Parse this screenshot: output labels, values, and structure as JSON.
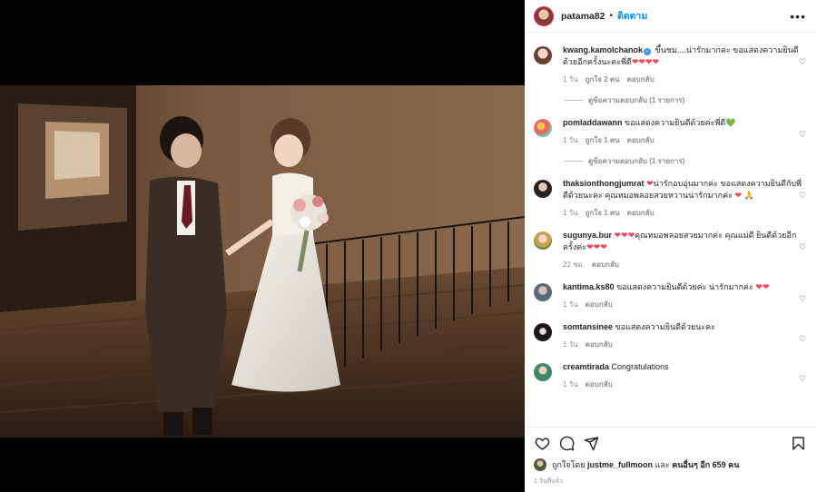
{
  "post": {
    "username": "patama82",
    "separator": "•",
    "follow_label": "ติดตาม",
    "more_label": "•••"
  },
  "comments": [
    {
      "username": "kwang.kamolchanok",
      "verified": true,
      "text": "ขึ้นชม....น่ารักมากค่ะ ขอแสดงความยินดีด้วยอีกครั้งนะคะพี่ดี",
      "emoji": "❤❤❤❤",
      "time": "1 วัน",
      "likes": "ถูกใจ 2 คน",
      "reply_label": "ตอบกลับ",
      "view_replies": "ดูข้อความตอบกลับ (1 รายการ)"
    },
    {
      "username": "pomladdawann",
      "text": "ขอแสดงความยินดีด้วยค่ะพี่ดี",
      "emoji": "💚",
      "time": "1 วัน",
      "likes": "ถูกใจ 1 คน",
      "reply_label": "ตอบกลับ",
      "view_replies": "ดูข้อความตอบกลับ (1 รายการ)"
    },
    {
      "username": "thaksionthongjumrat",
      "emoji_prefix": "❤",
      "text": "น่ารักอบอุ่นมากค่ะ ขอแสดงความยินดีกับพี่ดีด้วยนะคะ คุณหมอพลอยสวยหวานน่ารักมากค่ะ",
      "emoji": "❤ 🙏",
      "time": "1 วัน",
      "likes": "ถูกใจ 1 คน",
      "reply_label": "ตอบกลับ"
    },
    {
      "username": "sugunya.bur",
      "emoji_prefix": "❤❤❤",
      "text": "คุณหมอพลอยสวยมากค่ะ คุณแม่ดี ยินดีด้วยอีกครั้งค่ะ",
      "emoji": "❤❤❤",
      "time": "22 ชม.",
      "reply_label": "ตอบกลับ"
    },
    {
      "username": "kantima.ks80",
      "text": "ขอแสดงความยินดีด้วยค่ะ น่ารักมากค่ะ",
      "emoji": "❤❤",
      "time": "1 วัน",
      "reply_label": "ตอบกลับ"
    },
    {
      "username": "somtansinee",
      "text": "ขอแสดงความยินดีด้วยนะคะ",
      "time": "1 วัน",
      "reply_label": "ตอบกลับ"
    },
    {
      "username": "creamtirada",
      "text": "Congratulations",
      "time": "1 วัน",
      "reply_label": "ตอบกลับ"
    }
  ],
  "likes_line": {
    "prefix": "ถูกใจโดย",
    "user": "justme_fullmoon",
    "middle": "และ",
    "others": "คนอื่นๆ อีก 659 คน"
  },
  "posted_time": "1 วันที่แล้ว",
  "colors": {
    "link": "#0095f6",
    "heart": "#ed4956",
    "muted": "#8e8e8e"
  },
  "icons": [
    "heart-icon",
    "comment-icon",
    "share-icon",
    "bookmark-icon",
    "like-heart-icon"
  ]
}
